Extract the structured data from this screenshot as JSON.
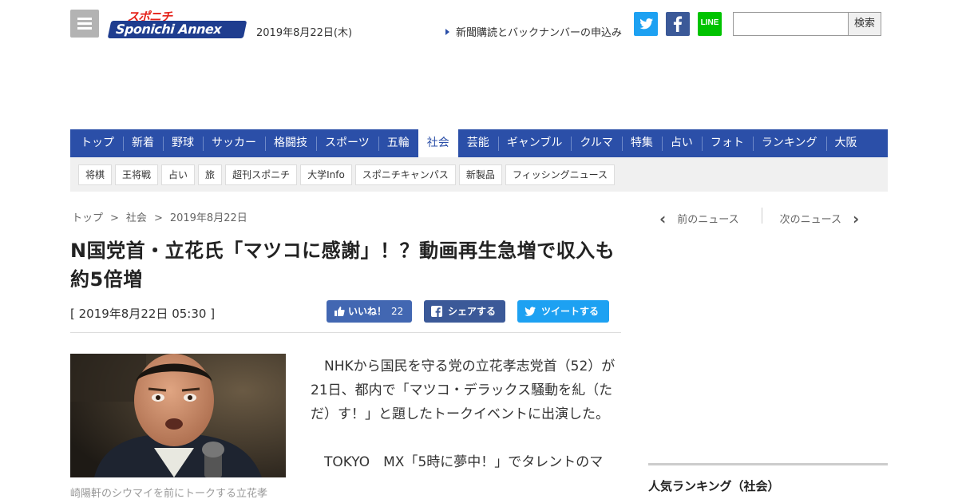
{
  "header": {
    "logo_top": "スポニチ",
    "logo_main": "Sponichi Annex",
    "date": "2019年8月22日(木)",
    "subscribe_link": "新聞購読とバックナンバーの申込み",
    "line_label": "LINE",
    "search": {
      "value": "",
      "placeholder": "",
      "button": "検索"
    }
  },
  "nav": {
    "items": [
      "トップ",
      "新着",
      "野球",
      "サッカー",
      "格闘技",
      "スポーツ",
      "五輪",
      "社会",
      "芸能",
      "ギャンブル",
      "クルマ",
      "特集",
      "占い",
      "フォト",
      "ランキング",
      "大阪"
    ],
    "active": "社会"
  },
  "subnav": {
    "items": [
      "将棋",
      "王将戦",
      "占い",
      "旅",
      "超刊スポニチ",
      "大学Info",
      "スポニチキャンパス",
      "新製品",
      "フィッシングニュース"
    ]
  },
  "breadcrumb": {
    "items": [
      "トップ",
      "社会",
      "2019年8月22日"
    ],
    "separator": ">"
  },
  "pager": {
    "prev": "前のニュース",
    "next": "次のニュース"
  },
  "article": {
    "headline": "N国党首・立花氏「マツコに感謝」！？動画再生急増で収入も約5倍増",
    "published": "[ 2019年8月22日 05:30 ]",
    "like_label": "いいね！",
    "like_count": "22",
    "share_label": "シェアする",
    "tweet_label": "ツイートする",
    "photo_caption": "崎陽軒のシウマイを前にトークする立花孝",
    "paragraphs": [
      "NHKから国民を守る党の立花孝志党首（52）が21日、都内で「マツコ・デラックス騒動を糺（ただ）す！」と題したトークイベントに出演した。",
      "TOKYO　MX「5時に夢中！」でタレントのマ"
    ]
  },
  "sidebar": {
    "ranking_title": "人気ランキング（社会）"
  },
  "colors": {
    "nav": "#2b4fa8",
    "twitter": "#1da1f2",
    "facebook": "#3b5998",
    "line": "#00c300",
    "logo_red": "#e5231b"
  }
}
